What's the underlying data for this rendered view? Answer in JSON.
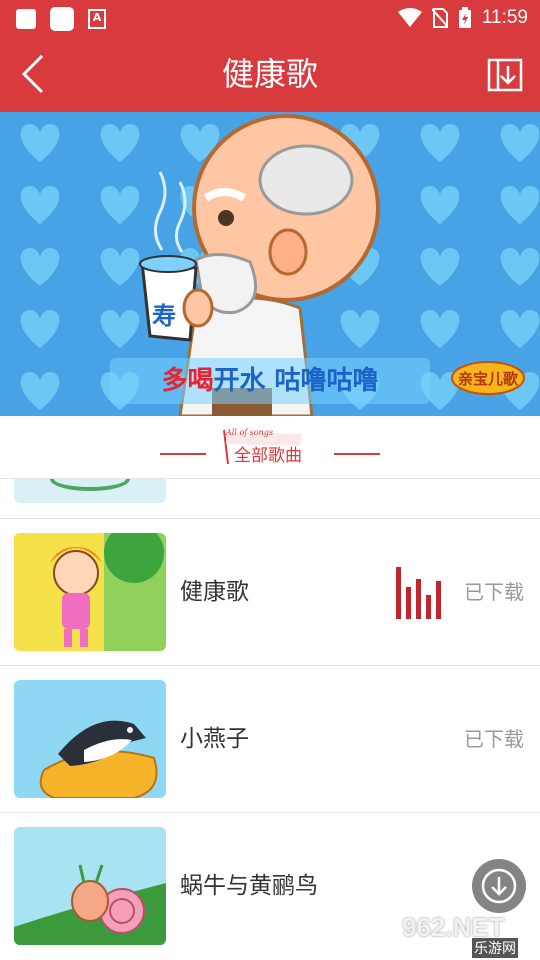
{
  "status_bar": {
    "time": "11:59"
  },
  "header": {
    "title": "健康歌"
  },
  "banner": {
    "caption_red": "多喝",
    "caption_blue": "开水 咕噜咕噜",
    "cup_text": "寿",
    "logo_text": "亲宝儿歌"
  },
  "section": {
    "small_text": "All of songs",
    "title": "全部歌曲"
  },
  "songs": [
    {
      "name": "健康歌",
      "status": "已下载",
      "playing": true
    },
    {
      "name": "小燕子",
      "status": "已下载",
      "playing": false
    },
    {
      "name": "蜗牛与黄鹂鸟",
      "status": "",
      "playing": false
    }
  ],
  "watermark": {
    "text": "962.NET",
    "sub": "乐游网"
  },
  "colors": {
    "brand": "#d83a3e",
    "muted": "#9a9a9a"
  }
}
